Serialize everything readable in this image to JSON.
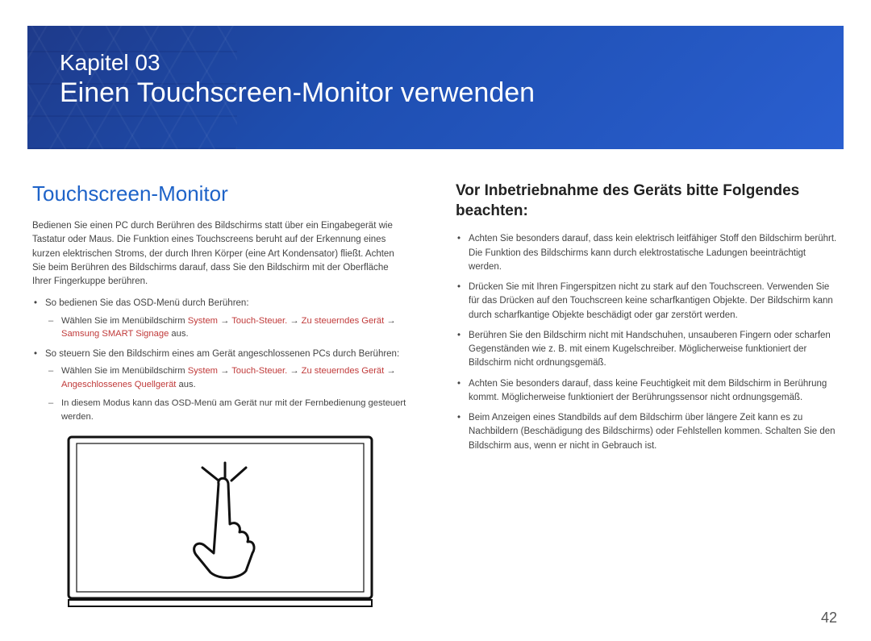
{
  "banner": {
    "chapter_label": "Kapitel 03",
    "chapter_title": "Einen Touchscreen-Monitor verwenden"
  },
  "left": {
    "heading": "Touchscreen-Monitor",
    "intro": "Bedienen Sie einen PC durch Berühren des Bildschirms statt über ein Eingabegerät wie Tastatur oder Maus. Die Funktion eines Touchscreens beruht auf der Erkennung eines kurzen elektrischen Stroms, der durch Ihren Körper (eine Art Kondensator) fließt. Achten Sie beim Berühren des Bildschirms darauf, dass Sie den Bildschirm mit der Oberfläche Ihrer Fingerkuppe berühren.",
    "item1": "So bedienen Sie das OSD-Menü durch Berühren:",
    "sub1_prefix": "Wählen Sie im Menübildschirm ",
    "sub1_hl1": "System",
    "sub1_arrow1": " → ",
    "sub1_hl2": "Touch-Steuer.",
    "sub1_arrow2": " → ",
    "sub1_hl3": "Zu steuerndes Gerät",
    "sub1_arrow3": " → ",
    "sub1_hl4": "Samsung SMART Signage",
    "sub1_suffix": " aus.",
    "item2": "So steuern Sie den Bildschirm eines am Gerät angeschlossenen PCs durch Berühren:",
    "sub2_prefix": "Wählen Sie im Menübildschirm ",
    "sub2_hl1": "System",
    "sub2_arrow1": " → ",
    "sub2_hl2": "Touch-Steuer.",
    "sub2_arrow2": " → ",
    "sub2_hl3": "Zu steuerndes Gerät",
    "sub2_arrow3": " → ",
    "sub2_hl4": "Angeschlossenes Quellgerät",
    "sub2_suffix": " aus.",
    "sub3": "In diesem Modus kann das OSD-Menü am Gerät nur mit der Fernbedienung gesteuert werden."
  },
  "right": {
    "heading": "Vor Inbetriebnahme des Geräts bitte Folgendes beachten:",
    "items": [
      "Achten Sie besonders darauf, dass kein elektrisch leitfähiger Stoff den Bildschirm berührt. Die Funktion des Bildschirms kann durch elektrostatische Ladungen beeinträchtigt werden.",
      "Drücken Sie mit Ihren Fingerspitzen nicht zu stark auf den Touchscreen. Verwenden Sie für das Drücken auf den Touchscreen keine scharfkantigen Objekte. Der Bildschirm kann durch scharfkantige Objekte beschädigt oder gar zerstört werden.",
      "Berühren Sie den Bildschirm nicht mit Handschuhen, unsauberen Fingern oder scharfen Gegenständen wie z. B. mit einem Kugelschreiber. Möglicherweise funktioniert der Bildschirm nicht ordnungsgemäß.",
      "Achten Sie besonders darauf, dass keine Feuchtigkeit mit dem Bildschirm in Berührung kommt. Möglicherweise funktioniert der Berührungssensor nicht ordnungsgemäß.",
      "Beim Anzeigen eines Standbilds auf dem Bildschirm über längere Zeit kann es zu Nachbildern (Beschädigung des Bildschirms) oder Fehlstellen kommen. Schalten Sie den Bildschirm aus, wenn er nicht in Gebrauch ist."
    ]
  },
  "page_number": "42"
}
